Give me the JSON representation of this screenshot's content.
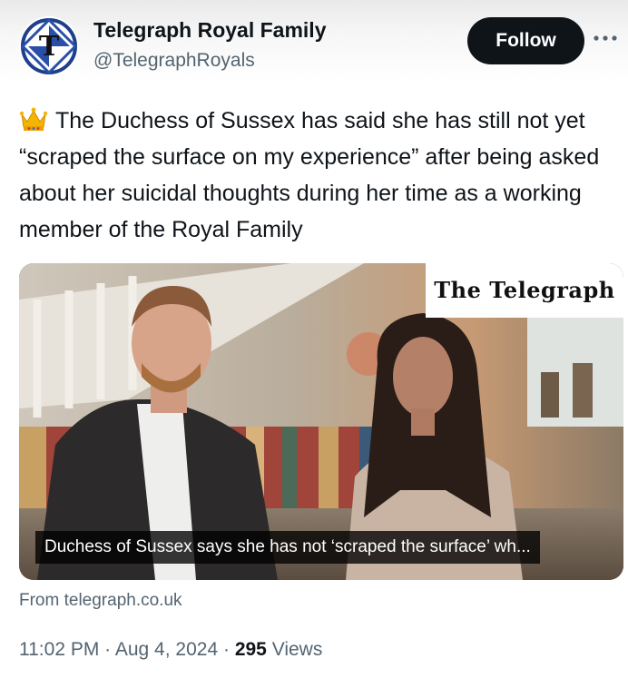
{
  "account": {
    "display_name": "Telegraph Royal Family",
    "handle": "@TelegraphRoyals",
    "avatar_icon": "telegraph-t-logo",
    "avatar_colors": {
      "ring": "#1e3f8a",
      "wedge": "#2a4fa8"
    }
  },
  "actions": {
    "follow_label": "Follow",
    "more_icon": "more-dots-icon"
  },
  "tweet": {
    "emoji_icon": "crown-emoji",
    "text": "The Duchess of Sussex has said she has still not yet “scraped the surface on my experience” after being asked about her suicidal thoughts during her time as a working member of the Royal Family"
  },
  "media": {
    "brand_text": "The Telegraph",
    "caption": "Duchess of Sussex says she has not ‘scraped the surface’ wh..."
  },
  "link_card": {
    "source": "From telegraph.co.uk"
  },
  "meta": {
    "time": "11:02 PM",
    "separator": "·",
    "date": "Aug 4, 2024",
    "views_count": "295",
    "views_label": "Views"
  }
}
